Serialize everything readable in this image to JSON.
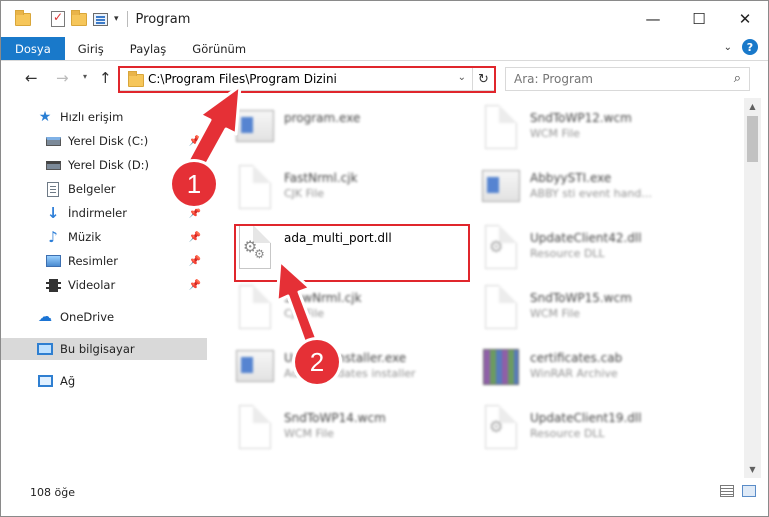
{
  "window": {
    "title": "Program",
    "controls": {
      "minimize": "—",
      "maximize": "☐",
      "close": "✕"
    }
  },
  "ribbon": {
    "tabs": [
      "Dosya",
      "Giriş",
      "Paylaş",
      "Görünüm"
    ],
    "help": "?"
  },
  "navbar": {
    "address": "C:\\Program Files\\Program Dizini",
    "search_placeholder": "Ara: Program"
  },
  "sidebar": {
    "items": [
      {
        "label": "Hızlı erişim",
        "icon": "star-icon"
      },
      {
        "label": "Yerel Disk (C:)",
        "icon": "drive-icon",
        "pinned": true
      },
      {
        "label": "Yerel Disk (D:)",
        "icon": "drive-icon"
      },
      {
        "label": "Belgeler",
        "icon": "document-icon",
        "pinned": true
      },
      {
        "label": "İndirmeler",
        "icon": "download-icon",
        "pinned": true
      },
      {
        "label": "Müzik",
        "icon": "music-icon",
        "pinned": true
      },
      {
        "label": "Resimler",
        "icon": "pictures-icon",
        "pinned": true
      },
      {
        "label": "Videolar",
        "icon": "video-icon",
        "pinned": true
      },
      {
        "label": "OneDrive",
        "icon": "cloud-icon"
      },
      {
        "label": "Bu bilgisayar",
        "icon": "computer-icon",
        "selected": true
      },
      {
        "label": "Ağ",
        "icon": "network-icon"
      }
    ]
  },
  "files": [
    {
      "name": "program.exe",
      "desc": "",
      "icon": "exe-icon"
    },
    {
      "name": "SndToWP12.wcm",
      "desc": "WCM File",
      "icon": "generic-file-icon"
    },
    {
      "name": "FastNrml.cjk",
      "desc": "CJK File",
      "icon": "generic-file-icon"
    },
    {
      "name": "AbbyySTI.exe",
      "desc": "ABBY sti event hand...",
      "icon": "exe-icon"
    },
    {
      "name": "ada_multi_port.dll",
      "desc": "",
      "icon": "dll-gear-icon"
    },
    {
      "name": "UpdateClient42.dll",
      "desc": "Resource DLL",
      "icon": "dll-gear-icon"
    },
    {
      "name": "SlowNrml.cjk",
      "desc": "CJK File",
      "icon": "generic-file-icon"
    },
    {
      "name": "SndToWP15.wcm",
      "desc": "WCM File",
      "icon": "generic-file-icon"
    },
    {
      "name": "UpdatesInstaller.exe",
      "desc": "Adobe Updates installer",
      "icon": "exe-icon"
    },
    {
      "name": "certificates.cab",
      "desc": "WinRAR Archive",
      "icon": "archive-icon"
    },
    {
      "name": "SndToWP14.wcm",
      "desc": "WCM File",
      "icon": "generic-file-icon"
    },
    {
      "name": "UpdateClient19.dll",
      "desc": "Resource DLL",
      "icon": "dll-gear-icon"
    }
  ],
  "status": {
    "count": "108 öğe"
  },
  "annotations": {
    "step1": "1",
    "step2": "2",
    "highlight_color": "#e0262c",
    "badge_color": "#e53036"
  }
}
